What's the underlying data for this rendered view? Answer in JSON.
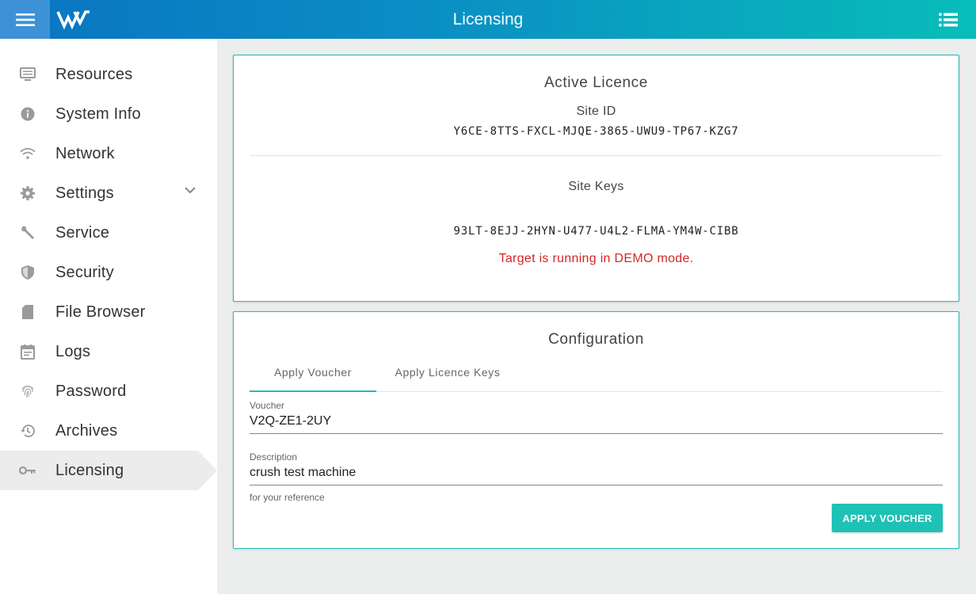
{
  "header": {
    "title": "Licensing",
    "menu_icon": "hamburger-icon",
    "logo_icon": "brand-logo",
    "list_icon": "list-icon"
  },
  "colors": {
    "header_start": "#0a74c2",
    "header_end": "#08bdb9",
    "accent": "#20bcb8",
    "button": "#1ec1b5",
    "error": "#d32626"
  },
  "sidebar": {
    "items": [
      {
        "label": "Resources",
        "icon": "monitor-icon"
      },
      {
        "label": "System Info",
        "icon": "info-icon"
      },
      {
        "label": "Network",
        "icon": "wifi-icon"
      },
      {
        "label": "Settings",
        "icon": "gear-icon",
        "expandable": true
      },
      {
        "label": "Service",
        "icon": "wrench-icon"
      },
      {
        "label": "Security",
        "icon": "shield-icon"
      },
      {
        "label": "File Browser",
        "icon": "sd-card-icon"
      },
      {
        "label": "Logs",
        "icon": "calendar-icon"
      },
      {
        "label": "Password",
        "icon": "fingerprint-icon"
      },
      {
        "label": "Archives",
        "icon": "history-icon"
      },
      {
        "label": "Licensing",
        "icon": "key-icon",
        "active": true
      }
    ]
  },
  "active_licence": {
    "title": "Active Licence",
    "site_id_label": "Site ID",
    "site_id": "Y6CE-8TTS-FXCL-MJQE-3865-UWU9-TP67-KZG7",
    "site_keys_label": "Site Keys",
    "site_key": "93LT-8EJJ-2HYN-U477-U4L2-FLMA-YM4W-CIBB",
    "status_message": "Target is running in DEMO mode."
  },
  "configuration": {
    "title": "Configuration",
    "tabs": [
      {
        "label": "Apply Voucher",
        "active": true
      },
      {
        "label": "Apply Licence Keys",
        "active": false
      }
    ],
    "voucher": {
      "label": "Voucher",
      "value": "V2Q-ZE1-2UY"
    },
    "description": {
      "label": "Description",
      "value": "crush test machine",
      "hint": "for your reference"
    },
    "apply_button_label": "APPLY VOUCHER"
  }
}
